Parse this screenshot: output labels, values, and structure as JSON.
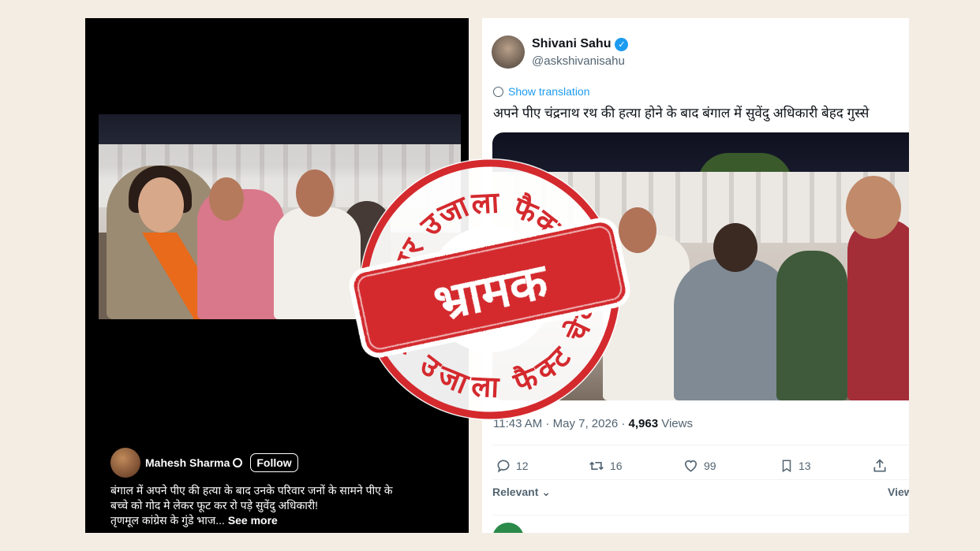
{
  "left_post": {
    "author": "Mahesh Sharma",
    "follow_label": "Follow",
    "caption_lines": [
      "बंगाल में अपने पीए की हत्या के बाद उनके परिवार जनों के सामने पीए के",
      "बच्चे को गोद मे लेकर फूट कर रो पड़े सुवेंदु अधिकारी!",
      "तृणमूल कांग्रेस के गुंडे भाज..."
    ],
    "see_more": "See more"
  },
  "tweet": {
    "author_name": "Shivani Sahu",
    "handle": "@askshivanisahu",
    "show_translation": "Show translation",
    "text": "अपने पीए चंद्रनाथ रथ की हत्या होने के बाद बंगाल में सुवेंदु अधिकारी बेहद गुस्से",
    "time": "11:43 AM",
    "date": "May 7, 2026",
    "views_count": "4,963",
    "views_label": "Views",
    "replies": "12",
    "reposts": "16",
    "likes": "99",
    "bookmarks": "13",
    "relevant_label": "Relevant",
    "view_label": "View"
  },
  "stamp": {
    "top_arc": "अमर उजाला फैक्ट चेक",
    "bottom_arc": "अमर उजाला फैक्ट चेक",
    "verdict": "भ्रामक",
    "color": "#d42a2e"
  },
  "colors": {
    "background": "#f4ede4",
    "twitter_blue": "#1d9bf0",
    "text_secondary": "#536471"
  }
}
